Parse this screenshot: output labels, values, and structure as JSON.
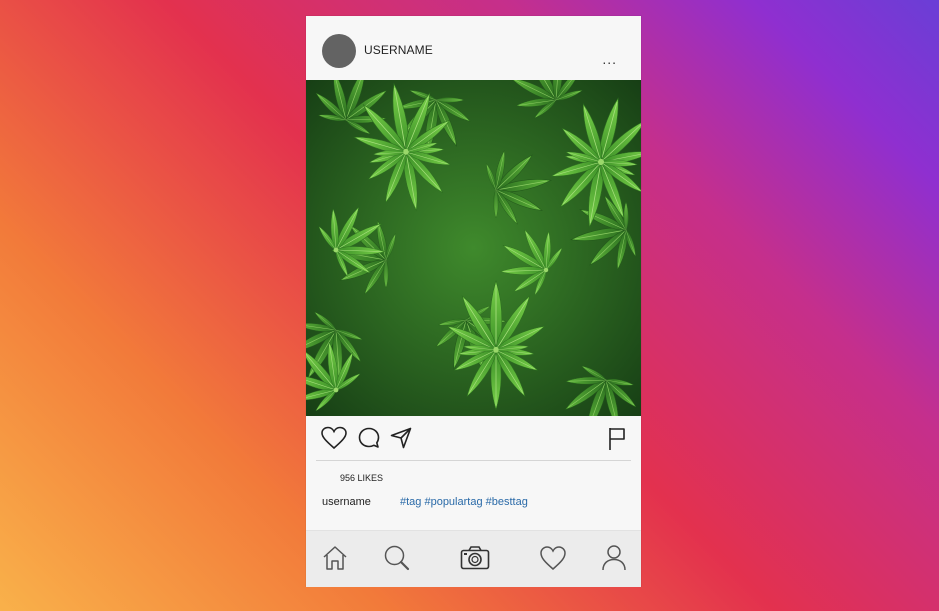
{
  "post": {
    "username": "USERNAME",
    "more_label": "...",
    "likes": "956 LIKES",
    "caption_user": "username",
    "caption_tags": "#tag #populartag #besttag"
  },
  "icons": {
    "actions": [
      "heart-icon",
      "comment-icon",
      "share-icon",
      "flag-icon"
    ],
    "tabbar": [
      "home-icon",
      "search-icon",
      "camera-icon",
      "heart-icon",
      "profile-icon"
    ]
  },
  "colors": {
    "gradient": [
      "#f9b14a",
      "#e3314e",
      "#c52f8c",
      "#6a3ed6"
    ],
    "hashtag": "#2a6aa8",
    "avatar": "#636363"
  }
}
